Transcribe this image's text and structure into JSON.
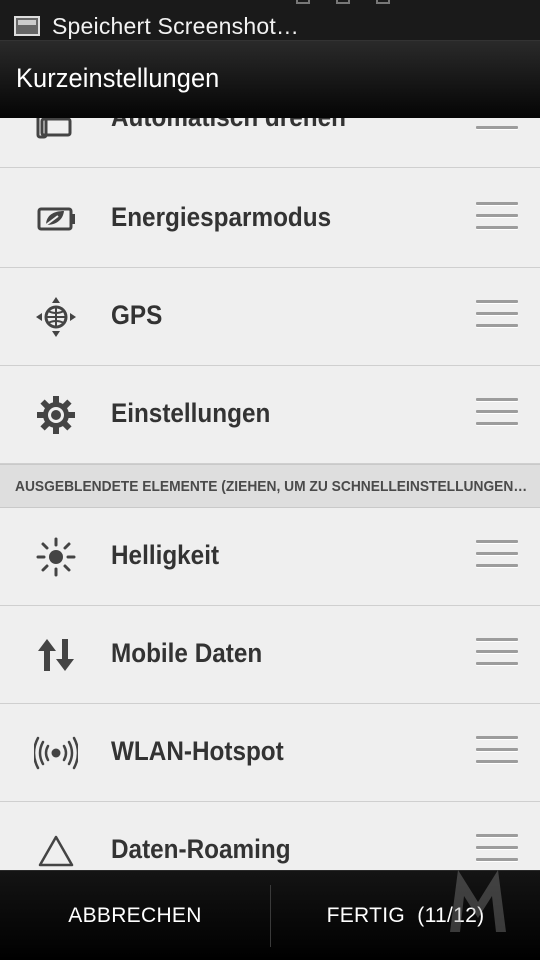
{
  "status_bar": {
    "notification_text": "Speichert Screenshot…",
    "notification_icon": "screenshot-icon"
  },
  "header": {
    "title": "Kurzeinstellungen"
  },
  "active_items": [
    {
      "label": "Automatisch drehen",
      "icon": "rotate-icon"
    },
    {
      "label": "Energiesparmodus",
      "icon": "power-saver-icon"
    },
    {
      "label": "GPS",
      "icon": "gps-icon"
    },
    {
      "label": "Einstellungen",
      "icon": "gear-icon"
    }
  ],
  "hidden_section": {
    "header": "AUSGEBLENDETE ELEMENTE (ZIEHEN, UM ZU SCHNELLEINSTELLUNGEN…"
  },
  "hidden_items": [
    {
      "label": "Helligkeit",
      "icon": "brightness-icon"
    },
    {
      "label": "Mobile Daten",
      "icon": "mobile-data-icon"
    },
    {
      "label": "WLAN-Hotspot",
      "icon": "hotspot-icon"
    },
    {
      "label": "Daten-Roaming",
      "icon": "roaming-icon"
    }
  ],
  "footer": {
    "cancel_label": "ABBRECHEN",
    "done_label": "FERTIG  (11/12)"
  },
  "colors": {
    "background": "#efefef",
    "bar_dark": "#000000",
    "text_dark": "#333333"
  }
}
